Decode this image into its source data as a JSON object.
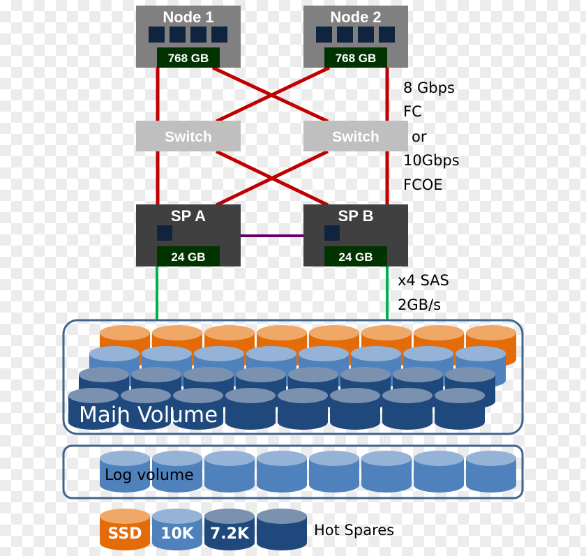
{
  "colors": {
    "node_box": "#808080",
    "switch_box": "#bfbfbf",
    "sp_box": "#404040",
    "memory_box": "#003300",
    "cpu_square": "#10243f",
    "fc_link": "#c00000",
    "sp_interconnect": "#660066",
    "sas_link": "#00b050",
    "volume_border": "#41648f",
    "ssd": "#e36c09",
    "ssd_top": "#f0a868",
    "10k": "#4f81bd",
    "10k_top": "#95b3d7",
    "7.2k": "#1f497d",
    "7.2k_top": "#7a92b0"
  },
  "nodes": [
    {
      "title": "Node 1",
      "memory": "768 GB",
      "cpus": 4
    },
    {
      "title": "Node 2",
      "memory": "768 GB",
      "cpus": 4
    }
  ],
  "switches": [
    {
      "label": "Switch"
    },
    {
      "label": "Switch"
    }
  ],
  "storage_processors": [
    {
      "title": "SP A",
      "memory": "24 GB"
    },
    {
      "title": "SP B",
      "memory": "24 GB"
    }
  ],
  "fc_link_label": [
    "8 Gbps",
    "FC",
    "or",
    "10Gbps",
    "FCOE"
  ],
  "sas_link_label": [
    "x4 SAS",
    "2GB/s"
  ],
  "main_volume": {
    "label": "Main Volume",
    "rows": [
      {
        "type": "ssd",
        "count": 8
      },
      {
        "type": "10k",
        "count": 8
      },
      {
        "type": "7.2k",
        "count": 8
      },
      {
        "type": "7.2k",
        "count": 8
      }
    ]
  },
  "log_volume": {
    "label": "Log volume",
    "type": "10k",
    "count": 8
  },
  "legend": {
    "items": [
      {
        "type": "ssd",
        "label": "SSD"
      },
      {
        "type": "10k",
        "label": "10K"
      },
      {
        "type": "7.2k",
        "label": "7.2K"
      },
      {
        "type": "7.2k",
        "label": ""
      }
    ],
    "hot_spares_label": "Hot Spares"
  }
}
